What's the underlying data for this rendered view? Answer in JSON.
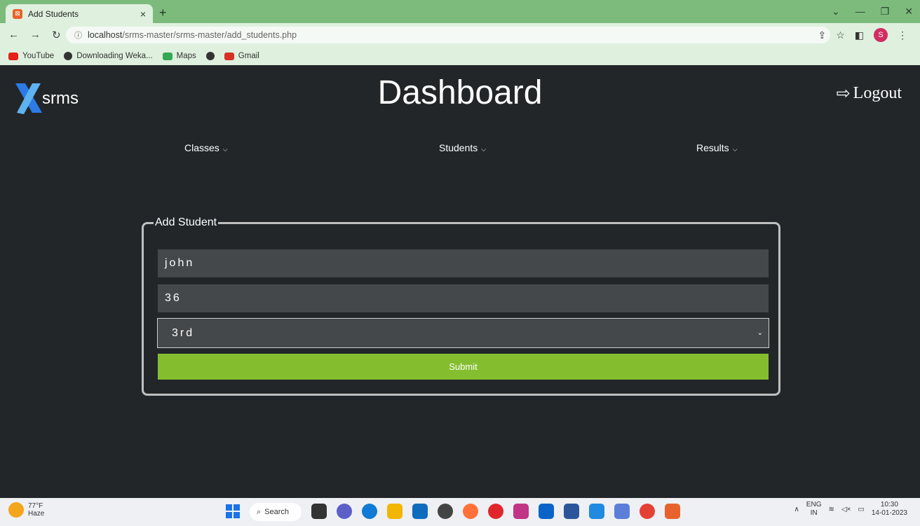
{
  "browser": {
    "tab_title": "Add Students",
    "tab_close": "×",
    "new_tab": "+",
    "url_host": "localhost",
    "url_path": "/srms-master/srms-master/add_students.php",
    "bookmarks": [
      {
        "label": "YouTube",
        "color": "#e62117"
      },
      {
        "label": "Downloading Weka...",
        "color": "#333333"
      },
      {
        "label": "Maps",
        "color": "#34a853"
      },
      {
        "label": "",
        "color": "#333333"
      },
      {
        "label": "Gmail",
        "color": "#d93025"
      }
    ],
    "profile_initial": "S"
  },
  "header": {
    "brand": "srms",
    "title": "Dashboard",
    "logout_label": "Logout"
  },
  "menu": {
    "items": [
      {
        "label": "Classes"
      },
      {
        "label": "Students"
      },
      {
        "label": "Results"
      }
    ]
  },
  "form": {
    "legend": "Add Student",
    "name_value": "john",
    "roll_value": "36",
    "class_selected": "3rd",
    "submit_label": "Submit"
  },
  "taskbar": {
    "temp": "77°F",
    "condition": "Haze",
    "search_label": "Search",
    "lang_top": "ENG",
    "lang_bottom": "IN",
    "time": "10:30",
    "date": "14-01-2023",
    "app_colors": [
      "#333333",
      "#5b5fc7",
      "#0f7bd6",
      "#f2b600",
      "#0f6cbd",
      "#444444",
      "#ff7139",
      "#e0262c",
      "#c13584",
      "#0a64c8",
      "#2b579a",
      "#1f8adf",
      "#5b7ed8",
      "#e44134",
      "#e8632b"
    ]
  },
  "colors": {
    "page_bg": "#222629",
    "submit_bg": "#84be2f",
    "field_bg": "#45484b"
  }
}
